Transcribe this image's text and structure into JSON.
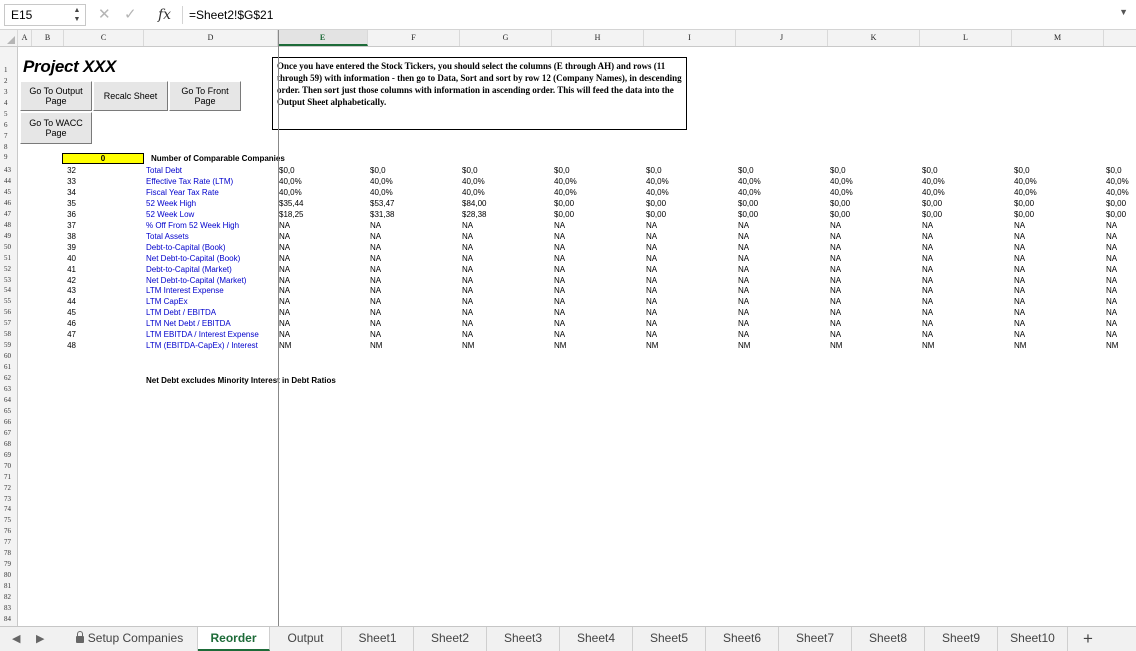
{
  "formula_bar": {
    "name_box": "E15",
    "fx": "fx",
    "formula": "=Sheet2!$G$21"
  },
  "columns": [
    "A",
    "B",
    "C",
    "D",
    "E",
    "F",
    "G",
    "H",
    "I",
    "J",
    "K",
    "L",
    "M"
  ],
  "selected_column": "E",
  "row_numbers": [
    "1",
    "2",
    "3",
    "4",
    "5",
    "6",
    "7",
    "8",
    "9",
    "43",
    "44",
    "45",
    "46",
    "47",
    "48",
    "49",
    "50",
    "51",
    "52",
    "53",
    "54",
    "55",
    "56",
    "57",
    "58",
    "59",
    "60",
    "61",
    "62",
    "63",
    "64",
    "65",
    "66",
    "67",
    "68",
    "69",
    "70",
    "71",
    "72",
    "73",
    "74",
    "75",
    "76",
    "77",
    "78",
    "79",
    "80",
    "81",
    "82",
    "83",
    "84"
  ],
  "title": "Project XXX",
  "buttons": {
    "output": "Go To Output Page",
    "recalc": "Recalc Sheet",
    "front": "Go To Front Page",
    "wacc": "Go To WACC Page"
  },
  "note": "Once you have entered the Stock Tickers, you should select the columns (E through AH) and rows (11 through 59) with information - then go to Data, Sort and sort by row 12 (Company Names), in descending order.  Then sort just those columns with information in ascending order.  This will feed the data into the Output Sheet alphabetically.",
  "comparable_count": "0",
  "comparable_label": "Number of Comparable Companies",
  "metrics": [
    {
      "idx": "32",
      "label": "Total Debt",
      "first": "$0,0",
      "vals": [
        "$0,0",
        "$0,0",
        "$0,0",
        "$0,0",
        "$0,0",
        "$0,0",
        "$0,0",
        "$0,0",
        "$0,0"
      ]
    },
    {
      "idx": "33",
      "label": "Effective Tax Rate (LTM)",
      "first": "40,0%",
      "vals": [
        "40,0%",
        "40,0%",
        "40,0%",
        "40,0%",
        "40,0%",
        "40,0%",
        "40,0%",
        "40,0%",
        "40,0%"
      ]
    },
    {
      "idx": "34",
      "label": "Fiscal Year Tax Rate",
      "first": "40,0%",
      "vals": [
        "40,0%",
        "40,0%",
        "40,0%",
        "40,0%",
        "40,0%",
        "40,0%",
        "40,0%",
        "40,0%",
        "40,0%"
      ]
    },
    {
      "idx": "35",
      "label": "52 Week High",
      "first": "$35,44",
      "vals": [
        "$53,47",
        "$84,00",
        "$0,00",
        "$0,00",
        "$0,00",
        "$0,00",
        "$0,00",
        "$0,00",
        "$0,00"
      ]
    },
    {
      "idx": "36",
      "label": "52 Week Low",
      "first": "$18,25",
      "vals": [
        "$31,38",
        "$28,38",
        "$0,00",
        "$0,00",
        "$0,00",
        "$0,00",
        "$0,00",
        "$0,00",
        "$0,00"
      ]
    },
    {
      "idx": "37",
      "label": "% Off From 52 Week High",
      "first": "NA",
      "vals": [
        "NA",
        "NA",
        "NA",
        "NA",
        "NA",
        "NA",
        "NA",
        "NA",
        "NA"
      ]
    },
    {
      "idx": "38",
      "label": "Total Assets",
      "first": "NA",
      "vals": [
        "NA",
        "NA",
        "NA",
        "NA",
        "NA",
        "NA",
        "NA",
        "NA",
        "NA"
      ]
    },
    {
      "idx": "39",
      "label": "Debt-to-Capital (Book)",
      "first": "NA",
      "vals": [
        "NA",
        "NA",
        "NA",
        "NA",
        "NA",
        "NA",
        "NA",
        "NA",
        "NA"
      ]
    },
    {
      "idx": "40",
      "label": "Net Debt-to-Capital (Book)",
      "first": "NA",
      "vals": [
        "NA",
        "NA",
        "NA",
        "NA",
        "NA",
        "NA",
        "NA",
        "NA",
        "NA"
      ]
    },
    {
      "idx": "41",
      "label": "Debt-to-Capital (Market)",
      "first": "NA",
      "vals": [
        "NA",
        "NA",
        "NA",
        "NA",
        "NA",
        "NA",
        "NA",
        "NA",
        "NA"
      ]
    },
    {
      "idx": "42",
      "label": "Net Debt-to-Capital (Market)",
      "first": "NA",
      "vals": [
        "NA",
        "NA",
        "NA",
        "NA",
        "NA",
        "NA",
        "NA",
        "NA",
        "NA"
      ]
    },
    {
      "idx": "43",
      "label": "LTM Interest Expense",
      "first": "NA",
      "vals": [
        "NA",
        "NA",
        "NA",
        "NA",
        "NA",
        "NA",
        "NA",
        "NA",
        "NA"
      ]
    },
    {
      "idx": "44",
      "label": "LTM CapEx",
      "first": "NA",
      "vals": [
        "NA",
        "NA",
        "NA",
        "NA",
        "NA",
        "NA",
        "NA",
        "NA",
        "NA"
      ]
    },
    {
      "idx": "45",
      "label": "LTM Debt / EBITDA",
      "first": "NA",
      "vals": [
        "NA",
        "NA",
        "NA",
        "NA",
        "NA",
        "NA",
        "NA",
        "NA",
        "NA"
      ]
    },
    {
      "idx": "46",
      "label": "LTM Net Debt / EBITDA",
      "first": "NA",
      "vals": [
        "NA",
        "NA",
        "NA",
        "NA",
        "NA",
        "NA",
        "NA",
        "NA",
        "NA"
      ]
    },
    {
      "idx": "47",
      "label": "LTM EBITDA / Interest Expense",
      "first": "NA",
      "vals": [
        "NA",
        "NA",
        "NA",
        "NA",
        "NA",
        "NA",
        "NA",
        "NA",
        "NA"
      ]
    },
    {
      "idx": "48",
      "label": "LTM (EBITDA-CapEx) / Interest",
      "first": "NM",
      "vals": [
        "NM",
        "NM",
        "NM",
        "NM",
        "NM",
        "NM",
        "NM",
        "NM",
        "NM"
      ]
    }
  ],
  "footnote": "Net Debt excludes Minority Interest in Debt Ratios",
  "sheet_tabs": [
    "Setup Companies",
    "Reorder",
    "Output",
    "Sheet1",
    "Sheet2",
    "Sheet3",
    "Sheet4",
    "Sheet5",
    "Sheet6",
    "Sheet7",
    "Sheet8",
    "Sheet9",
    "Sheet10"
  ],
  "active_tab": "Reorder",
  "add_sheet": "+"
}
